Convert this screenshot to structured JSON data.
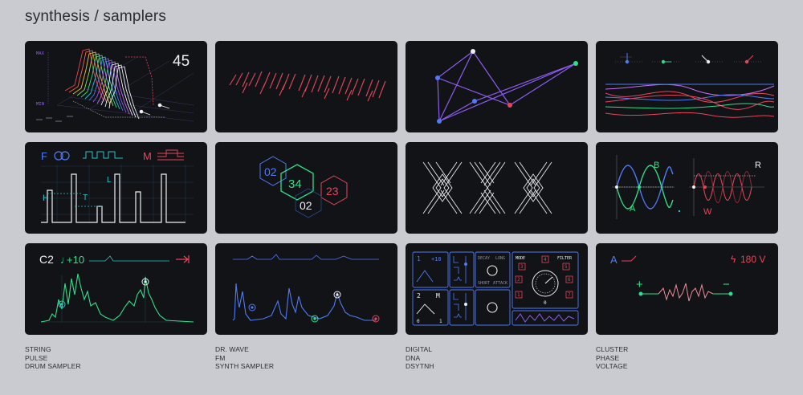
{
  "header": {
    "title": "synthesis / samplers"
  },
  "tiles": {
    "t1": {
      "max_label": "MAX",
      "min_label": "MIN",
      "value": "45"
    },
    "t5": {
      "f_label": "F",
      "m_label": "M",
      "h_label": "H",
      "t_label": "T",
      "l_label": "L"
    },
    "t6": {
      "hex1": "02",
      "hex2": "34",
      "hex3": "23",
      "hex4": "02"
    },
    "t8": {
      "b_label": "B",
      "a_label": "A",
      "r_label": "R",
      "w_label": "W"
    },
    "t9": {
      "note": "C2",
      "offset": "+10"
    },
    "t11": {
      "v1": "1",
      "v2": "+10",
      "v3": "2",
      "v4": "M",
      "v5": "0",
      "v6": "1",
      "decay": "DECAY",
      "long": "LONG",
      "short": "SHORT",
      "attack": "ATTACK",
      "mode": "MODE",
      "filter": "FILTER",
      "n1": "3",
      "n2": "4",
      "n3": "5",
      "n4": "2",
      "n5": "6",
      "n6": "1",
      "n7": "7",
      "n8": "0"
    },
    "t12": {
      "a_label": "A",
      "voltage": "180 V",
      "plus": "+",
      "minus": "−"
    }
  },
  "captions": [
    {
      "lines": [
        "STRING",
        "PULSE",
        "DRUM SAMPLER"
      ]
    },
    {
      "lines": [
        "DR. WAVE",
        "FM",
        "SYNTH SAMPLER"
      ]
    },
    {
      "lines": [
        "DIGITAL",
        "DNA",
        "DSYTNH"
      ]
    },
    {
      "lines": [
        "CLUSTER",
        "PHASE",
        "VOLTAGE"
      ]
    }
  ],
  "colors": {
    "tile_bg": "#121317",
    "page_bg": "#c9cbd0",
    "red": "#e5465a",
    "purple": "#8e5cf0",
    "blue": "#4f7bf5",
    "green": "#2fe08a",
    "teal": "#2ac4c8",
    "white": "#eef0f5"
  }
}
